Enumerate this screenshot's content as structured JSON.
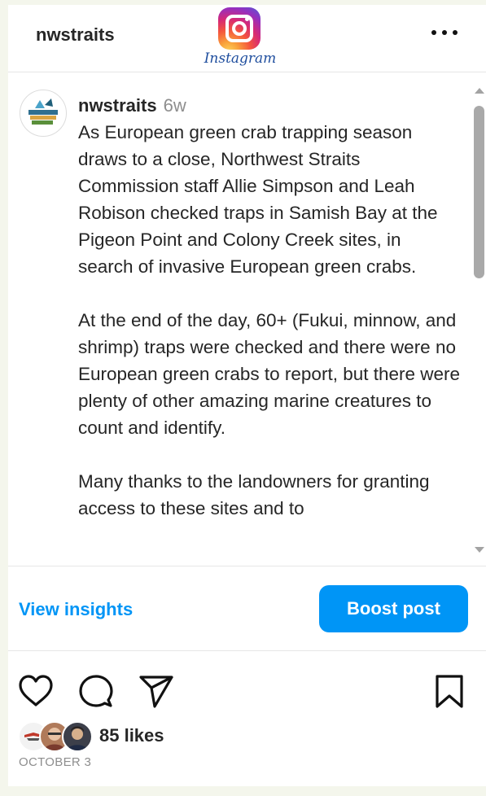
{
  "header": {
    "username": "nwstraits",
    "logo_text": "Instagram",
    "more_icon": "more-horizontal-icon"
  },
  "post": {
    "author": "nwstraits",
    "age": "6w",
    "paragraphs": [
      "As European green crab trapping season draws to a close, Northwest Straits Commission staff Allie Simpson and Leah Robison checked traps in Samish Bay at the Pigeon Point and Colony Creek sites, in search of invasive European green crabs.",
      "At the end of the day, 60+ (Fukui, minnow, and shrimp) traps were checked and there were no European green crabs to report, but there were plenty of other amazing marine creatures to count and identify.",
      "Many thanks to the landowners for granting access to these sites and to"
    ]
  },
  "actions": {
    "view_insights": "View insights",
    "boost_post": "Boost post",
    "icons": [
      "heart-icon",
      "comment-icon",
      "share-icon",
      "bookmark-icon"
    ]
  },
  "engagement": {
    "likes": "85 likes",
    "date": "OCTOBER 3"
  },
  "colors": {
    "accent": "#0095f6",
    "page_background": "#f4f6ec",
    "text": "#262626",
    "muted": "#8e8e8e"
  }
}
